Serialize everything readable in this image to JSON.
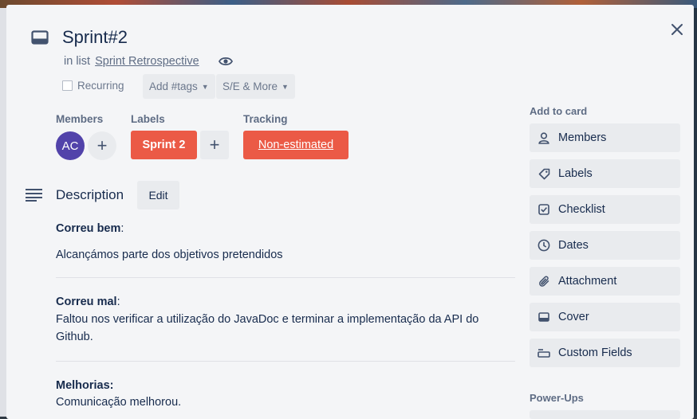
{
  "card": {
    "title": "Sprint#2",
    "in_list_prefix": "in list",
    "list_name": "Sprint Retrospective"
  },
  "toolbar": {
    "recurring_label": "Recurring",
    "tags_label": "Add #tags",
    "more_label": "S/E & More"
  },
  "members": {
    "label": "Members",
    "avatar_initials": "AC"
  },
  "labels": {
    "label": "Labels",
    "chip": "Sprint 2",
    "chip_color": "#eb5a46"
  },
  "tracking": {
    "label": "Tracking",
    "value": "Non-estimated"
  },
  "description": {
    "title": "Description",
    "edit_label": "Edit",
    "sections": [
      {
        "heading": "Correu bem",
        "text": "Alcançámos parte dos objetivos pretendidos"
      },
      {
        "heading": "Correu mal",
        "text_line1": "Faltou nos verificar a utilização do JavaDoc e terminar a implementação da API do",
        "text_line2": "Github."
      },
      {
        "heading": "Melhorias:",
        "text": "Comunicação melhorou."
      }
    ]
  },
  "sidebar": {
    "add_to_card_title": "Add to card",
    "buttons": [
      {
        "label": "Members",
        "icon": "person-icon"
      },
      {
        "label": "Labels",
        "icon": "tag-icon"
      },
      {
        "label": "Checklist",
        "icon": "checkbox-icon"
      },
      {
        "label": "Dates",
        "icon": "clock-icon"
      },
      {
        "label": "Attachment",
        "icon": "paperclip-icon"
      },
      {
        "label": "Cover",
        "icon": "cover-icon"
      },
      {
        "label": "Custom Fields",
        "icon": "custom-fields-icon"
      }
    ],
    "powerups_title": "Power-Ups"
  }
}
